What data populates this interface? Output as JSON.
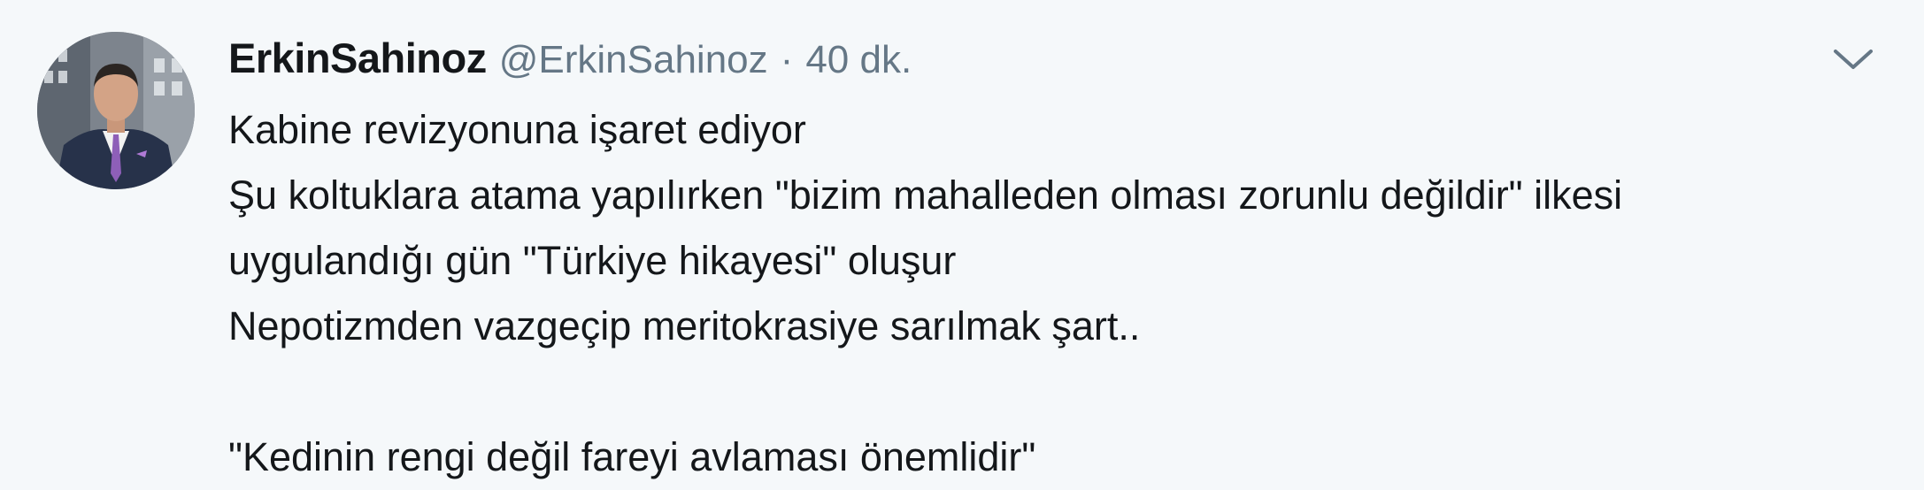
{
  "tweet": {
    "fullname": "ErkinSahinoz",
    "username": "@ErkinSahinoz",
    "separator": "·",
    "time": "40 dk.",
    "lines": [
      "Kabine revizyonuna işaret ediyor",
      "Şu koltuklara atama yapılırken \"bizim mahalleden olması zorunlu değildir\" ilkesi",
      "uygulandığı gün \"Türkiye hikayesi\" oluşur",
      "Nepotizmden vazgeçip meritokrasiye sarılmak şart..",
      "",
      "\"Kedinin rengi değil fareyi avlaması önemlidir\""
    ]
  },
  "icons": {
    "avatar": "user-avatar-photo",
    "menu": "chevron-down-icon"
  },
  "colors": {
    "background": "#f5f8fa",
    "text": "#14171a",
    "muted": "#657786"
  }
}
